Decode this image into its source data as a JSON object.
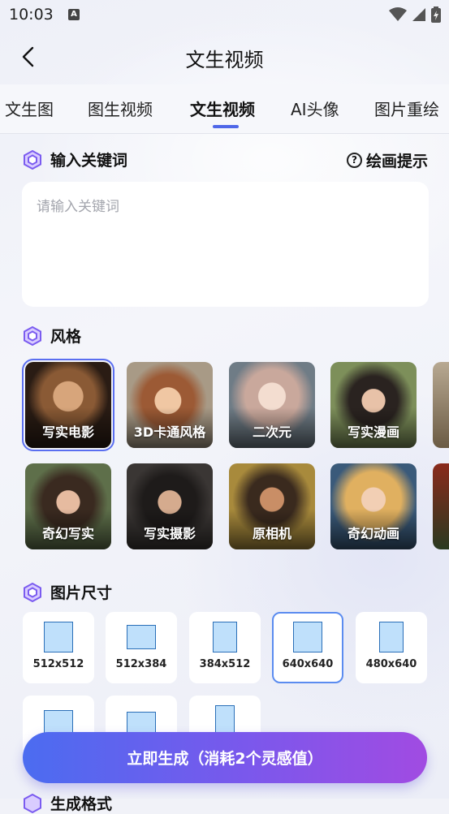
{
  "status_bar": {
    "time": "10:03",
    "a_badge": "A"
  },
  "header": {
    "title": "文生视频"
  },
  "tabs": [
    {
      "label": "文生图"
    },
    {
      "label": "图生视频"
    },
    {
      "label": "文生视频",
      "active": true
    },
    {
      "label": "AI头像"
    },
    {
      "label": "图片重绘"
    }
  ],
  "keyword_section": {
    "title": "输入关键词",
    "hint_label": "绘画提示",
    "placeholder": "请输入关键词",
    "value": ""
  },
  "style_section": {
    "title": "风格",
    "styles": [
      {
        "label": "写实电影",
        "selected": true
      },
      {
        "label": "3D卡通风格"
      },
      {
        "label": "二次元"
      },
      {
        "label": "写实漫画"
      },
      {
        "label": ""
      },
      {
        "label": "奇幻写实"
      },
      {
        "label": "写实摄影"
      },
      {
        "label": "原相机"
      },
      {
        "label": "奇幻动画"
      },
      {
        "label": ""
      }
    ]
  },
  "size_section": {
    "title": "图片尺寸",
    "sizes": [
      {
        "label": "512x512"
      },
      {
        "label": "512x384"
      },
      {
        "label": "384x512"
      },
      {
        "label": "640x640",
        "selected": true
      },
      {
        "label": "480x640"
      },
      {
        "label": ""
      },
      {
        "label": ""
      },
      {
        "label": ""
      }
    ]
  },
  "generate_button": {
    "label": "立即生成（消耗2个灵感值）"
  },
  "next_section": {
    "title": "生成格式"
  },
  "colors": {
    "accent": "#4f67e8",
    "button_start": "#4b6cf0",
    "button_end": "#a14be2",
    "icon_purple": "#7b5cf0"
  }
}
